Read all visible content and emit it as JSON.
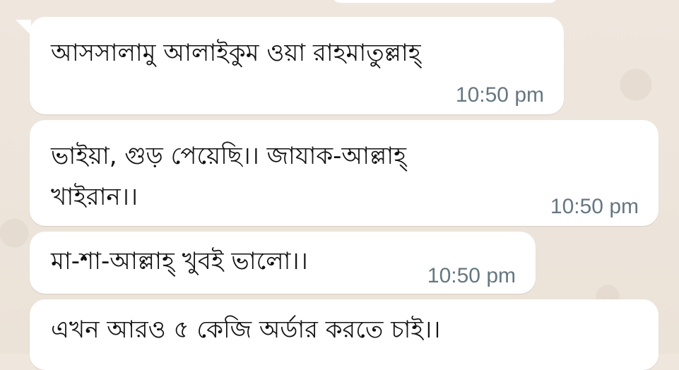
{
  "chat": {
    "messages": [
      {
        "text": "আসসালামু আলাইকুম ওয়া রাহমাতুল্লাহ্",
        "time": "10:50 pm"
      },
      {
        "text": "ভাইয়া, গুড় পেয়েছি।। জাযাক-আল্লাহ্\nখাইরান।।",
        "time": "10:50 pm"
      },
      {
        "text": "মা-শা-আল্লাহ্ খুবই ভালো।।",
        "time": "10:50 pm"
      },
      {
        "text": "এখন আরও ৫ কেজি অর্ডার করতে চাই।।",
        "time": ""
      }
    ]
  },
  "colors": {
    "background": "#efe7de",
    "bubble": "#ffffff",
    "timestamp": "#667781"
  }
}
